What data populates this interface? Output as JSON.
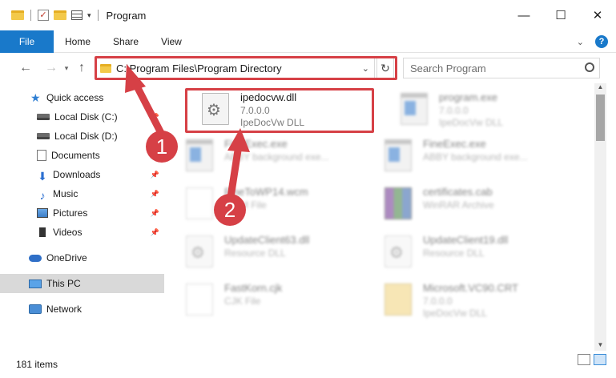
{
  "window": {
    "title": "Program",
    "minimize": "—",
    "maximize": "☐",
    "close": "✕"
  },
  "ribbon": {
    "file": "File",
    "home": "Home",
    "share": "Share",
    "view": "View"
  },
  "address": {
    "path": "C:\\Program Files\\Program Directory",
    "search_placeholder": "Search Program"
  },
  "sidebar": {
    "items": [
      {
        "label": "Quick access",
        "icon": "star-icon",
        "pinned": false
      },
      {
        "label": "Local Disk (C:)",
        "icon": "drive-icon",
        "pinned": true
      },
      {
        "label": "Local Disk (D:)",
        "icon": "drive-icon",
        "pinned": false
      },
      {
        "label": "Documents",
        "icon": "documents-icon",
        "pinned": true
      },
      {
        "label": "Downloads",
        "icon": "downloads-icon",
        "pinned": true
      },
      {
        "label": "Music",
        "icon": "music-icon",
        "pinned": true
      },
      {
        "label": "Pictures",
        "icon": "pictures-icon",
        "pinned": true
      },
      {
        "label": "Videos",
        "icon": "videos-icon",
        "pinned": true
      },
      {
        "label": "OneDrive",
        "icon": "onedrive-icon",
        "pinned": false
      },
      {
        "label": "This PC",
        "icon": "this-pc-icon",
        "pinned": false,
        "selected": true
      },
      {
        "label": "Network",
        "icon": "network-icon",
        "pinned": false
      }
    ]
  },
  "files": [
    {
      "name": "ipedocvw.dll",
      "line1": "7.0.0.0",
      "line2": "IpeDocVw DLL",
      "icon": "dll-icon"
    },
    {
      "name": "program.exe",
      "line1": "7.0.0.0",
      "line2": "IpeDocVw DLL",
      "icon": "exe-icon"
    },
    {
      "name": "FineExec.exe",
      "line1": "ABBY background exe...",
      "line2": "",
      "icon": "exe-icon"
    },
    {
      "name": "FineExec.exe",
      "line1": "ABBY background exe...",
      "line2": "",
      "icon": "exe-icon"
    },
    {
      "name": "FineToWP14.wcm",
      "line1": "WCM File",
      "line2": "",
      "icon": "document-icon"
    },
    {
      "name": "certificates.cab",
      "line1": "WinRAR Archive",
      "line2": "",
      "icon": "winrar-icon"
    },
    {
      "name": "UpdateClient63.dll",
      "line1": "Resource DLL",
      "line2": "",
      "icon": "dll-icon"
    },
    {
      "name": "UpdateClient19.dll",
      "line1": "Resource DLL",
      "line2": "",
      "icon": "dll-icon"
    },
    {
      "name": "FastKorn.cjk",
      "line1": "CJK File",
      "line2": "",
      "icon": "document-icon"
    },
    {
      "name": "Microsoft.VC90.CRT",
      "line1": "7.0.0.0",
      "line2": "IpeDocVw DLL",
      "icon": "folder-zip-icon"
    }
  ],
  "status": {
    "count": "181 items"
  },
  "annotations": {
    "step1": "1",
    "step2": "2",
    "color": "#d64046"
  }
}
